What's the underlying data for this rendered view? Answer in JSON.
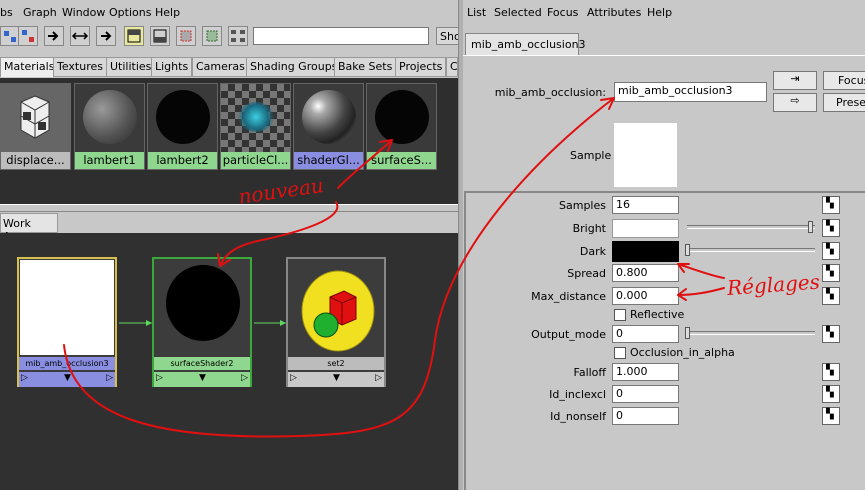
{
  "hypershade": {
    "menus": [
      "bs",
      "Graph",
      "Window",
      "Options",
      "Help"
    ],
    "show_btn": "Sho",
    "tabs": [
      "Materials",
      "Textures",
      "Utilities",
      "Lights",
      "Cameras",
      "Shading Groups",
      "Bake Sets",
      "Projects",
      "C"
    ],
    "swatches": [
      "displace...",
      "lambert1",
      "lambert2",
      "particleCl...",
      "shaderGl...",
      "surfaceS..."
    ],
    "work_tab": "Work Area",
    "nodes": [
      "mib_amb_occlusion3",
      "surfaceShader2",
      "set2"
    ]
  },
  "attr": {
    "menus": [
      "List",
      "Selected",
      "Focus",
      "Attributes",
      "Help"
    ],
    "tab": "mib_amb_occlusion3",
    "name_label": "mib_amb_occlusion:",
    "name_value": "mib_amb_occlusion3",
    "focus_btn": "Focus",
    "presets_btn": "Preset",
    "sample_label": "Sample",
    "rows": {
      "samples": {
        "label": "Samples",
        "value": "16"
      },
      "bright": {
        "label": "Bright"
      },
      "dark": {
        "label": "Dark"
      },
      "spread": {
        "label": "Spread",
        "value": "0.800"
      },
      "max_distance": {
        "label": "Max_distance",
        "value": "0.000"
      },
      "reflective": {
        "label": "Reflective"
      },
      "output_mode": {
        "label": "Output_mode",
        "value": "0"
      },
      "occlusion_in_alpha": {
        "label": "Occlusion_in_alpha"
      },
      "falloff": {
        "label": "Falloff",
        "value": "1.000"
      },
      "id_inclexcl": {
        "label": "Id_inclexcl",
        "value": "0"
      },
      "id_nonself": {
        "label": "Id_nonself",
        "value": "0"
      }
    }
  },
  "annotations": {
    "nouveau": "nouveau",
    "reglages": "Réglages",
    "color": "#e01010"
  }
}
